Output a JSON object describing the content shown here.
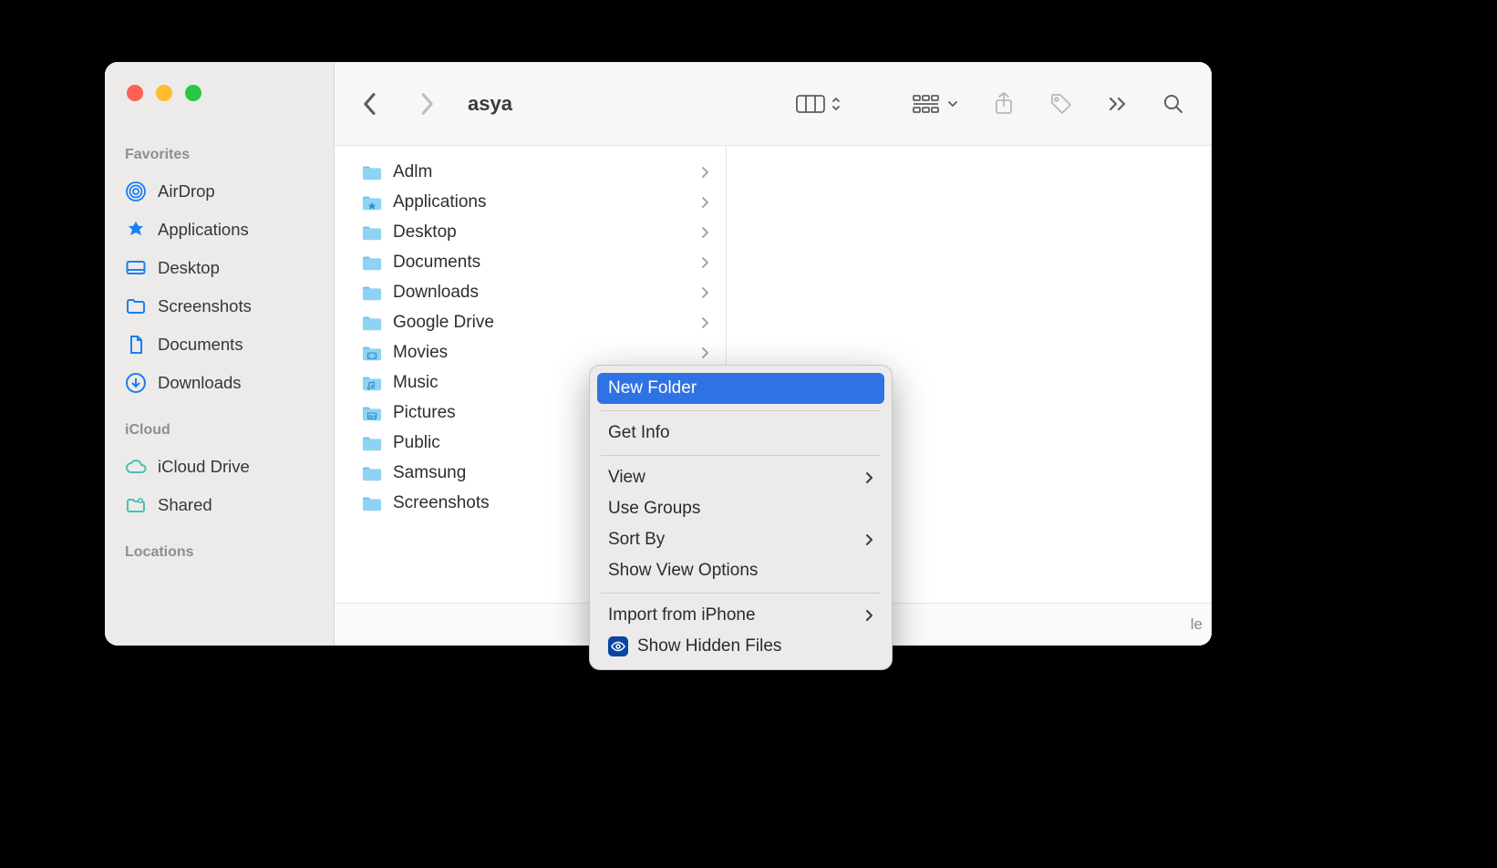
{
  "window_title": "asya",
  "status_text_suffix": "le",
  "sidebar": {
    "sections": [
      {
        "label": "Favorites",
        "items": [
          {
            "icon": "airdrop",
            "label": "AirDrop"
          },
          {
            "icon": "apps",
            "label": "Applications"
          },
          {
            "icon": "desktop",
            "label": "Desktop"
          },
          {
            "icon": "folder",
            "label": "Screenshots"
          },
          {
            "icon": "doc",
            "label": "Documents"
          },
          {
            "icon": "download",
            "label": "Downloads"
          }
        ]
      },
      {
        "label": "iCloud",
        "items": [
          {
            "icon": "cloud",
            "label": "iCloud Drive"
          },
          {
            "icon": "shared",
            "label": "Shared"
          }
        ]
      },
      {
        "label": "Locations",
        "items": []
      }
    ]
  },
  "column_items": [
    {
      "label": "Adlm",
      "icon": "folder"
    },
    {
      "label": "Applications",
      "icon": "apps-folder"
    },
    {
      "label": "Desktop",
      "icon": "folder"
    },
    {
      "label": "Documents",
      "icon": "folder"
    },
    {
      "label": "Downloads",
      "icon": "folder"
    },
    {
      "label": "Google Drive",
      "icon": "folder"
    },
    {
      "label": "Movies",
      "icon": "movies-folder"
    },
    {
      "label": "Music",
      "icon": "music-folder"
    },
    {
      "label": "Pictures",
      "icon": "pictures-folder"
    },
    {
      "label": "Public",
      "icon": "folder"
    },
    {
      "label": "Samsung",
      "icon": "folder"
    },
    {
      "label": "Screenshots",
      "icon": "folder"
    }
  ],
  "context_menu": {
    "groups": [
      [
        {
          "label": "New Folder",
          "highlighted": true
        }
      ],
      [
        {
          "label": "Get Info"
        }
      ],
      [
        {
          "label": "View",
          "submenu": true
        },
        {
          "label": "Use Groups"
        },
        {
          "label": "Sort By",
          "submenu": true
        },
        {
          "label": "Show View Options"
        }
      ],
      [
        {
          "label": "Import from iPhone",
          "submenu": true
        },
        {
          "label": "Show Hidden Files",
          "icon": "eye"
        }
      ]
    ]
  },
  "colors": {
    "sidebar_icon_blue": "#1a7ff3",
    "sidebar_icon_teal": "#44c1b8",
    "folder_fill": "#8fd3f4",
    "folder_tab": "#6cc0ea",
    "menu_highlight": "#2f72e3"
  }
}
